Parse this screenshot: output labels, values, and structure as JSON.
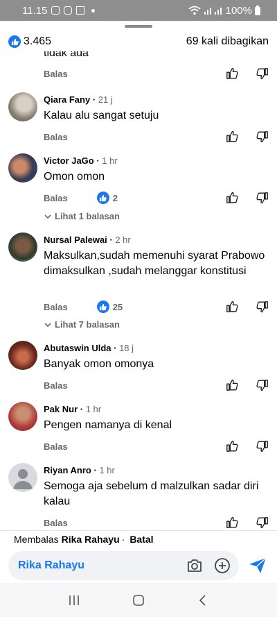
{
  "status_bar": {
    "time": "11.15",
    "battery": "100%"
  },
  "header": {
    "reaction_count": "3.465",
    "shares": "69 kali dibagikan"
  },
  "partial_comment": {
    "text": "tidak ada",
    "reply_label": "Balas"
  },
  "comments": [
    {
      "name": "Qiara Fany",
      "time": "21 j",
      "text": "Kalau alu sangat setuju",
      "reply_label": "Balas"
    },
    {
      "name": "Victor JaGo",
      "time": "1 hr",
      "text": "Omon omon",
      "reply_label": "Balas",
      "reactions": "2",
      "view_replies": "Lihat 1 balasan"
    },
    {
      "name": "Nursal Palewai",
      "time": "2 hr",
      "text": "Maksulkan,sudah memenuhi syarat Prabowo dimaksulkan ,sudah melanggar konstitusi",
      "reply_label": "Balas",
      "reactions": "25",
      "view_replies": "Lihat 7 balasan"
    },
    {
      "name": "Abutaswin Ulda",
      "time": "18 j",
      "text": "Banyak omon omonya",
      "reply_label": "Balas"
    },
    {
      "name": "Pak Nur",
      "time": "1 hr",
      "text": "Pengen namanya di kenal",
      "reply_label": "Balas"
    },
    {
      "name": "Riyan Anro",
      "time": "1 hr",
      "text": "Semoga aja sebelum d malzulkan sadar diri kalau",
      "reply_label": "Balas"
    }
  ],
  "reply_bar": {
    "prefix": "Membalas",
    "target": "Rika Rahayu",
    "cancel": "Batal"
  },
  "composer": {
    "value": "Rika Rahayu"
  },
  "colors": {
    "accent": "#1877f2",
    "muted": "#65676b"
  }
}
